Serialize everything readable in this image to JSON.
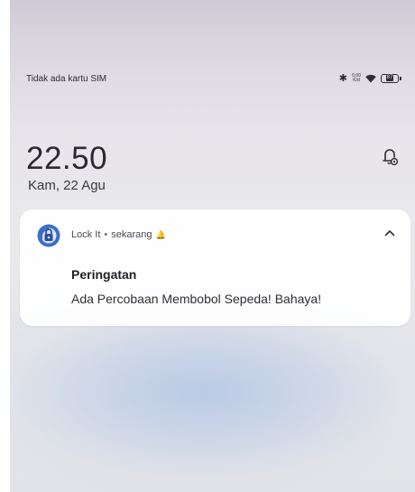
{
  "status_bar": {
    "carrier": "Tidak ada kartu SIM",
    "icons": [
      "bluetooth-icon",
      "network-speed-icon",
      "wifi-icon",
      "battery-icon"
    ],
    "network_speed": [
      "0,00",
      "K/d"
    ],
    "battery_level": "87"
  },
  "lockscreen": {
    "time": "22.50",
    "date": "Kam, 22 Agu",
    "bell_icon": "notification-settings-icon"
  },
  "notification": {
    "app_name": "Lock It",
    "separator": "•",
    "time": "sekarang",
    "title": "Peringatan",
    "body": "Ada Percobaan Membobol Sepeda! Bahaya!",
    "app_icon_color": "#3b6fc7",
    "expand_icon": "chevron-up-icon"
  }
}
